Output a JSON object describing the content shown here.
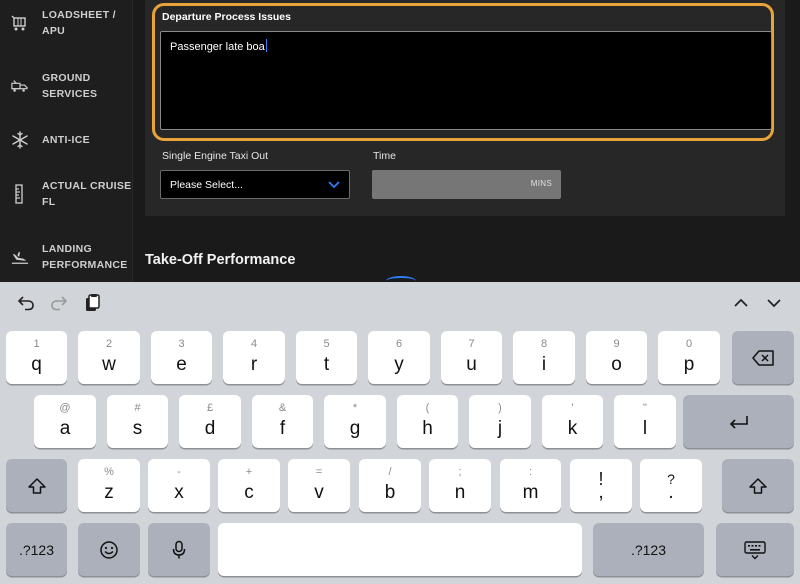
{
  "sidebar": {
    "items": [
      {
        "label": "LOADSHEET /\nAPU",
        "icon": "trolley-icon"
      },
      {
        "label": "GROUND\nSERVICES",
        "icon": "fuel-truck-icon"
      },
      {
        "label": "ANTI-ICE",
        "icon": "snowflake-icon"
      },
      {
        "label": "ACTUAL CRUISE\nFL",
        "icon": "ruler-icon"
      },
      {
        "label": "LANDING\nPERFORMANCE",
        "icon": "landing-plane-icon"
      }
    ]
  },
  "form": {
    "departure_title": "Departure Process Issues",
    "departure_value": "Passenger late boa",
    "taxi_label": "Single Engine Taxi Out",
    "taxi_select_value": "Please Select...",
    "time_label": "Time",
    "time_unit": "MINS"
  },
  "section_heading": "Take-Off Performance",
  "colors": {
    "focus_ring": "#e8a33a",
    "caret": "#2f7cf6",
    "accent_blue": "#2f7cf6"
  },
  "keyboard": {
    "row1": [
      {
        "alt": "1",
        "ch": "q"
      },
      {
        "alt": "2",
        "ch": "w"
      },
      {
        "alt": "3",
        "ch": "e"
      },
      {
        "alt": "4",
        "ch": "r"
      },
      {
        "alt": "5",
        "ch": "t"
      },
      {
        "alt": "6",
        "ch": "y"
      },
      {
        "alt": "7",
        "ch": "u"
      },
      {
        "alt": "8",
        "ch": "i"
      },
      {
        "alt": "9",
        "ch": "o"
      },
      {
        "alt": "0",
        "ch": "p"
      }
    ],
    "row2": [
      {
        "alt": "@",
        "ch": "a"
      },
      {
        "alt": "#",
        "ch": "s"
      },
      {
        "alt": "£",
        "ch": "d"
      },
      {
        "alt": "&",
        "ch": "f"
      },
      {
        "alt": "*",
        "ch": "g"
      },
      {
        "alt": "(",
        "ch": "h"
      },
      {
        "alt": ")",
        "ch": "j"
      },
      {
        "alt": "'",
        "ch": "k"
      },
      {
        "alt": "\"",
        "ch": "l"
      }
    ],
    "row3": [
      {
        "alt": "%",
        "ch": "z"
      },
      {
        "alt": "-",
        "ch": "x"
      },
      {
        "alt": "+",
        "ch": "c"
      },
      {
        "alt": "=",
        "ch": "v"
      },
      {
        "alt": "/",
        "ch": "b"
      },
      {
        "alt": ";",
        "ch": "n"
      },
      {
        "alt": ":",
        "ch": "m"
      },
      {
        "alt": "!",
        "ch": ","
      },
      {
        "alt": "?",
        "ch": "."
      }
    ],
    "numbers_label": ".?123"
  }
}
